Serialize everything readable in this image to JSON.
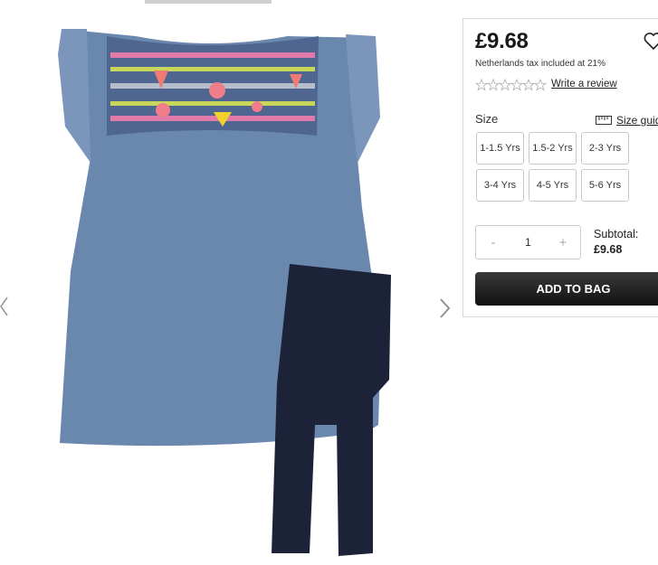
{
  "product": {
    "price": "£9.68",
    "tax_note": "Netherlands tax included at 21%",
    "rating_stars": 0,
    "write_review": "Write a review"
  },
  "size": {
    "label": "Size",
    "guide_label": "Size guide",
    "options": [
      "1-1.5 Yrs",
      "1.5-2 Yrs",
      "2-3 Yrs",
      "3-4 Yrs",
      "4-5 Yrs",
      "5-6 Yrs"
    ]
  },
  "quantity": {
    "minus": "-",
    "value": "1",
    "plus": "+"
  },
  "subtotal": {
    "label": "Subtotal:",
    "value": "£9.68"
  },
  "cart": {
    "add_label": "ADD TO BAG"
  },
  "icons": {
    "wishlist": "heart-icon",
    "size_guide": "ruler-icon",
    "prev": "chevron-left-icon",
    "next": "chevron-right-icon"
  }
}
